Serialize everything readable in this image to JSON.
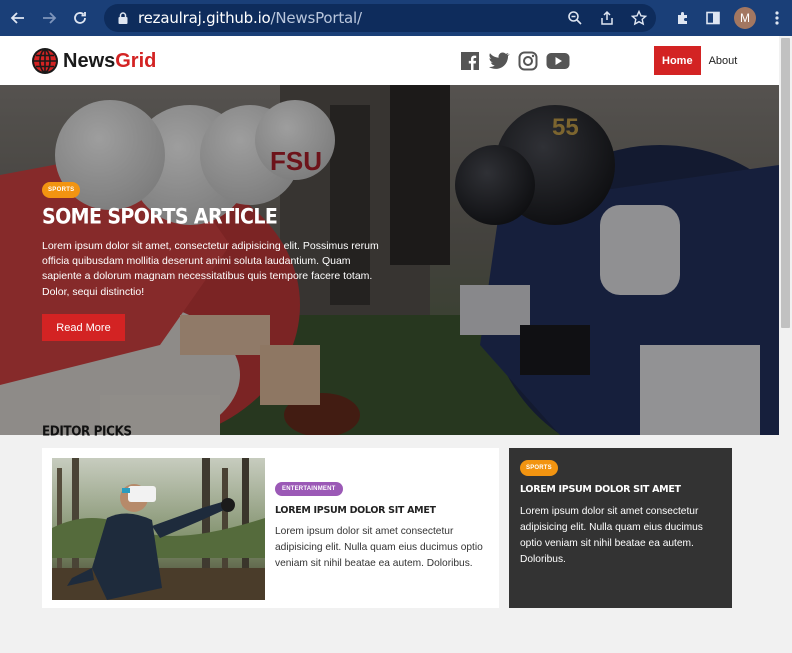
{
  "browser": {
    "url_host": "rezaulraj.github.io",
    "url_path": "/NewsPortal/",
    "profile_initial": "M"
  },
  "site": {
    "logo_news": "News",
    "logo_grid": "Grid",
    "nav": {
      "home": "Home",
      "about": "About"
    }
  },
  "hero": {
    "badge": "SPORTS",
    "title": "Some Sports Article",
    "text": "Lorem ipsum dolor sit amet, consectetur adipisicing elit. Possimus rerum officia quibusdam mollitia deserunt animi soluta laudantium. Quam sapiente a dolorum magnam necessitatibus quis tempore facere totam. Dolor, sequi distinctio!",
    "button": "Read More"
  },
  "editor_picks": {
    "title": "EDITOR PICKS",
    "card1": {
      "badge": "ENTERTAINMENT",
      "title": "Lorem ipsum dolor sit amet",
      "text": "Lorem ipsum dolor sit amet consectetur adipisicing elit. Nulla quam eius ducimus optio veniam sit nihil beatae ea autem. Doloribus."
    },
    "card2": {
      "badge": "SPORTS",
      "title": "Lorem ipsum dolor sit amet",
      "text": "Lorem ipsum dolor sit amet consectetur adipisicing elit. Nulla quam eius ducimus optio veniam sit nihil beatae ea autem. Doloribus."
    }
  },
  "colors": {
    "brand_red": "#d32323",
    "sports_orange": "#f29411",
    "entertainment_purple": "#9b59b6",
    "chrome_blue": "#1a3f78"
  }
}
